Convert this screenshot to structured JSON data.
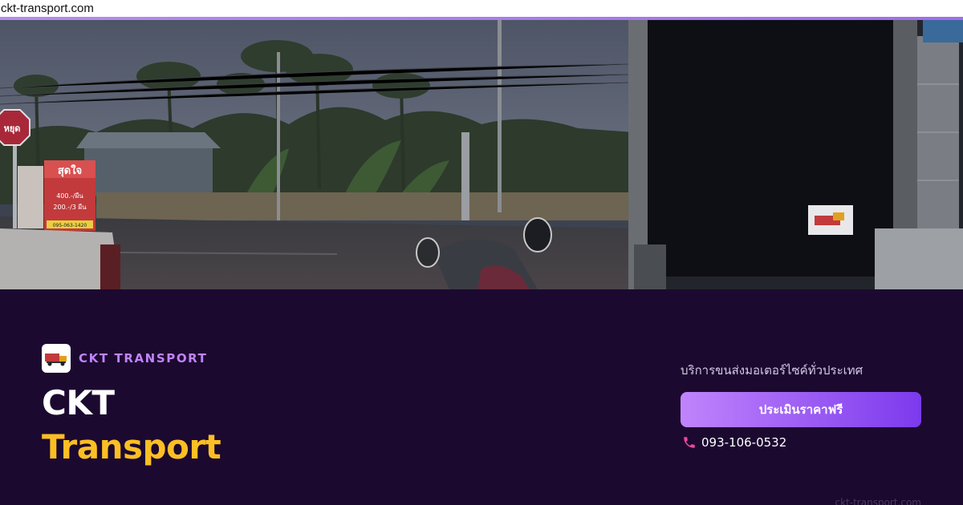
{
  "browser": {
    "url": "ckt-transport.com"
  },
  "hero": {
    "sign_stop": "หยุด",
    "sign_shop_line1": "สุดใจ",
    "sign_shop_price1": "400.-/ผืน",
    "sign_shop_price2": "200.-/3 ผืน",
    "sign_shop_phone": "095-063-1420"
  },
  "brand": {
    "name": "CKT TRANSPORT",
    "logo_icon": "ckt-logo-truck"
  },
  "title": {
    "line1": "CKT",
    "line2": "Transport"
  },
  "cta_panel": {
    "tagline": "บริการขนส่งมอเตอร์ไซค์ทั่วประเทศ",
    "button_label": "ประเมินราคาฟรี",
    "phone_icon": "phone-icon",
    "phone": "093-106-0532"
  },
  "footer": {
    "domain": "ckt-transport.com"
  },
  "colors": {
    "panel_bg": "#1c0930",
    "brand_accent": "#c084fc",
    "title_highlight": "#fbbf24",
    "button_gradient_start": "#c084fc",
    "button_gradient_end": "#7c3aed",
    "phone_icon": "#ec4899"
  }
}
